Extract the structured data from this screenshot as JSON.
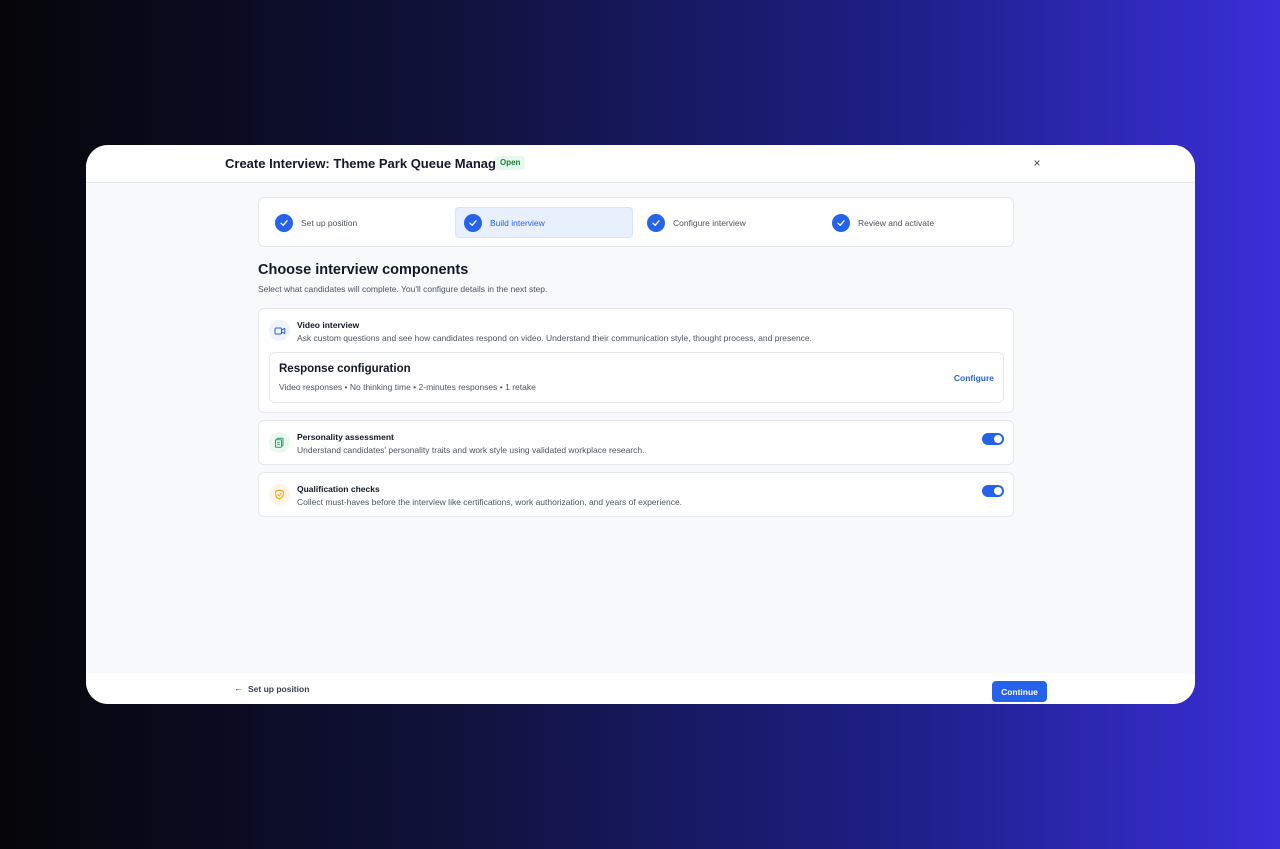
{
  "modal": {
    "title": "Create Interview: Theme Park Queue Manager",
    "status_badge": "Open",
    "close_icon": "×"
  },
  "stepper": {
    "steps": [
      {
        "label": "Set up position",
        "completed": true,
        "active": false
      },
      {
        "label": "Build interview",
        "completed": true,
        "active": true
      },
      {
        "label": "Configure interview",
        "completed": true,
        "active": false
      },
      {
        "label": "Review and activate",
        "completed": true,
        "active": false
      }
    ]
  },
  "main": {
    "title": "Choose interview components",
    "subtitle": "Select what candidates will complete. You'll configure details in the next step.",
    "components": [
      {
        "title": "Video interview",
        "description": "Ask custom questions and see how candidates respond on video. Understand their communication style, thought process, and presence.",
        "icon": "video-camera-icon",
        "response_configuration": {
          "title": "Response configuration",
          "details": "Video responses • No thinking time • 2-minutes responses • 1 retake",
          "action_label": "Configure"
        }
      },
      {
        "title": "Personality assessment",
        "description": "Understand candidates' personality traits and work style using validated workplace research.",
        "icon": "document-stack-icon",
        "enabled": true
      },
      {
        "title": "Qualification checks",
        "description": "Collect must-haves before the interview like certifications, work authorization, and years of experience.",
        "icon": "shield-check-icon",
        "enabled": true
      }
    ]
  },
  "footer": {
    "back_label": "Set up position",
    "back_icon": "←",
    "continue_label": "Continue"
  },
  "colors": {
    "accent": "#2563eb",
    "badge_bg": "#e7f7ec",
    "badge_text": "#15803d",
    "personality_icon": "#22a06b",
    "qualification_icon": "#f59e0b"
  }
}
